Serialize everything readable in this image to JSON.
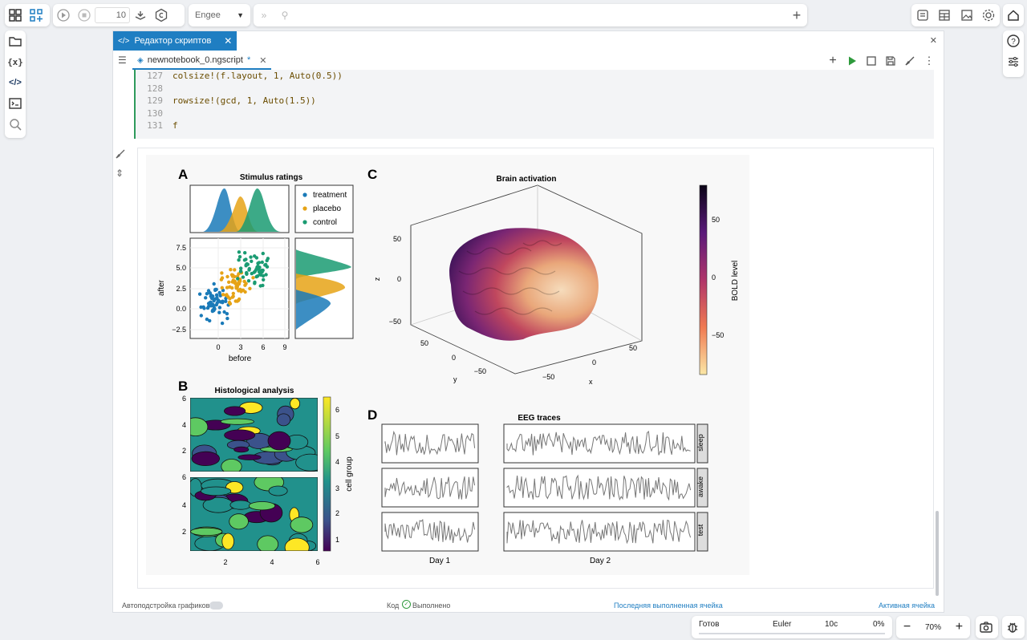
{
  "toolbar": {
    "step_value": "10",
    "solver_select": "Engee"
  },
  "editor": {
    "panel_tab": "Редактор скриптов",
    "file_tab": "newnotebook_0.ngscript",
    "modified_mark": "*"
  },
  "code_lines": [
    {
      "n": "127",
      "t": "colsize!(f.layout, 1, Auto(0.5))"
    },
    {
      "n": "128",
      "t": ""
    },
    {
      "n": "129",
      "t": "rowsize!(gcd, 1, Auto(1.5))"
    },
    {
      "n": "130",
      "t": ""
    },
    {
      "n": "131",
      "t": "f"
    }
  ],
  "figure": {
    "panel_a_letter": "A",
    "panel_b_letter": "B",
    "panel_c_letter": "C",
    "panel_d_letter": "D",
    "stimulus_title": "Stimulus ratings",
    "legend": [
      {
        "name": "treatment",
        "color": "#1a7ab8"
      },
      {
        "name": "placebo",
        "color": "#e6a316"
      },
      {
        "name": "control",
        "color": "#1a9b72"
      }
    ],
    "scatter_ylabel": "after",
    "scatter_xlabel": "before",
    "scatter_yticks": [
      "7.5",
      "5.0",
      "2.5",
      "0.0",
      "−2.5"
    ],
    "scatter_xticks": [
      "0",
      "3",
      "6",
      "9"
    ],
    "brain_title": "Brain activation",
    "brain_zticks": [
      "50",
      "0",
      "−50"
    ],
    "brain_ylabel": "y",
    "brain_xlabel": "x",
    "brain_zlabel": "z",
    "brain_yticks": [
      "50",
      "0",
      "−50"
    ],
    "brain_xticks": [
      "50",
      "0",
      "−50"
    ],
    "cbar_label": "BOLD level",
    "cbar_ticks": [
      "50",
      "0",
      "−50"
    ],
    "histo_title": "Histological analysis",
    "histo_yticks": [
      "6",
      "4",
      "2"
    ],
    "histo_xticks": [
      "2",
      "4",
      "6"
    ],
    "cellgroup_label": "cell group",
    "cellgroup_ticks": [
      "6",
      "5",
      "4",
      "3",
      "2",
      "1"
    ],
    "eeg_title": "EEG traces",
    "eeg_rows": [
      "sleep",
      "awake",
      "test"
    ],
    "eeg_cols": [
      "Day 1",
      "Day 2"
    ]
  },
  "statusbar": {
    "auto_plot": "Автоподстройка графиков",
    "code_label": "Код",
    "done": "Выполнено",
    "last_cell": "Последняя выполненная ячейка",
    "active_cell": "Активная ячейка"
  },
  "status": {
    "ready": "Готов",
    "solver": "Euler",
    "time": "10с",
    "progress": "0%"
  },
  "zoom": {
    "value": "70%"
  }
}
